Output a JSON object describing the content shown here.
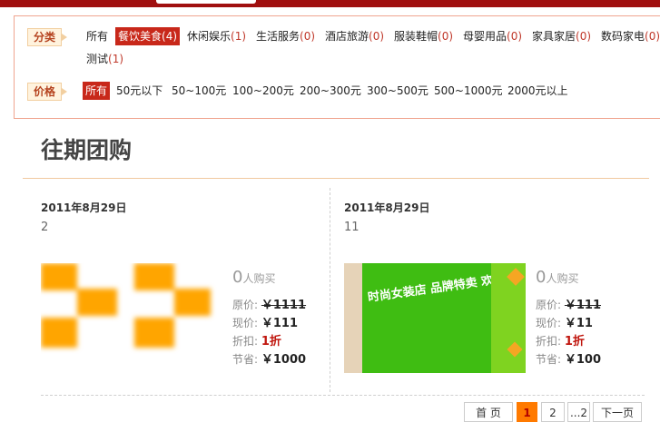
{
  "filters": {
    "category_label": "分类",
    "categories": [
      {
        "label": "所有",
        "count": ""
      },
      {
        "label": "餐饮美食",
        "count": "(4)"
      },
      {
        "label": "休闲娱乐",
        "count": "(1)"
      },
      {
        "label": "生活服务",
        "count": "(0)"
      },
      {
        "label": "酒店旅游",
        "count": "(0)"
      },
      {
        "label": "服装鞋帽",
        "count": "(0)"
      },
      {
        "label": "母婴用品",
        "count": "(0)"
      },
      {
        "label": "家具家居",
        "count": "(0)"
      },
      {
        "label": "数码家电",
        "count": "(0)"
      },
      {
        "label": "测试",
        "count": "(1)"
      }
    ],
    "price_label": "价格",
    "prices": [
      "所有",
      "50元以下",
      "50~100元",
      "100~200元",
      "200~300元",
      "300~500元",
      "500~1000元",
      "2000元以上"
    ]
  },
  "section": {
    "title": "往期团购"
  },
  "deals": [
    {
      "date": "2011年8月29日",
      "name": "2",
      "sold_count": "0",
      "sold_suffix": "人购买",
      "original_label": "原价:",
      "original_price": "￥1111",
      "current_label": "现价:",
      "current_price": "￥111",
      "discount_label": "折扣:",
      "discount": "1折",
      "saving_label": "节省:",
      "saving": "￥1000",
      "image_icon": "image-placeholder-icon"
    },
    {
      "date": "2011年8月29日",
      "name": "11",
      "sold_count": "0",
      "sold_suffix": "人购买",
      "original_label": "原价:",
      "original_price": "￥111",
      "current_label": "现价:",
      "current_price": "￥11",
      "discount_label": "折扣:",
      "discount": "1折",
      "saving_label": "节省:",
      "saving": "￥100",
      "image_text": "时尚女装店 品牌特卖 欢迎光临 优惠多多"
    }
  ],
  "pagination": {
    "first": "首 页",
    "pages": [
      "1",
      "2"
    ],
    "ellipsis": "...2",
    "next": "下一页",
    "current": "1"
  },
  "colors": {
    "brand_red": "#a00f0f",
    "active_filter": "#c8281a",
    "count_red": "#c0392b",
    "current_page": "#ff7a00",
    "banner_green": "#3fbd12"
  }
}
